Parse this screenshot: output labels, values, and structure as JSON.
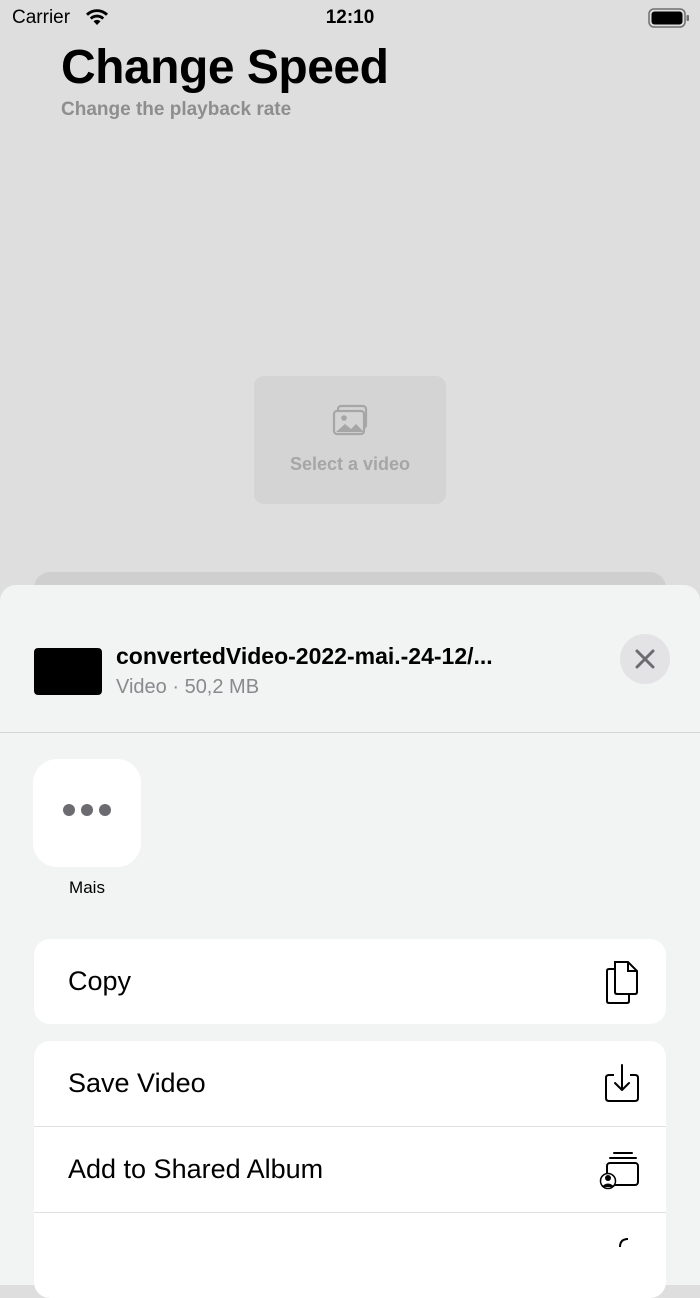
{
  "status_bar": {
    "carrier": "Carrier",
    "time": "12:10"
  },
  "app": {
    "title": "Change Speed",
    "subtitle": "Change the playback rate",
    "select_label": "Select a video"
  },
  "share_sheet": {
    "file_name": "convertedVideo-2022-mai.-24-12/...",
    "file_meta": "Video · 50,2 MB",
    "more_app_label": "Mais",
    "actions_group_1": [
      {
        "label": "Copy",
        "icon": "copy-icon"
      }
    ],
    "actions_group_2": [
      {
        "label": "Save Video",
        "icon": "save-icon"
      },
      {
        "label": "Add to Shared Album",
        "icon": "shared-album-icon"
      },
      {
        "label": "",
        "icon": "more-action-icon"
      }
    ]
  }
}
